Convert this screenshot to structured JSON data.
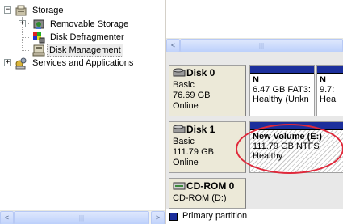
{
  "tree": {
    "items": [
      {
        "label": "Storage",
        "expander": "−",
        "icon": "storage-icon"
      },
      {
        "label": "Removable Storage",
        "expander": "+",
        "icon": "removable-storage-icon"
      },
      {
        "label": "Disk Defragmenter",
        "expander": "",
        "icon": "defragmenter-icon"
      },
      {
        "label": "Disk Management",
        "expander": "",
        "icon": "disk-management-icon",
        "selected": true
      },
      {
        "label": "Services and Applications",
        "expander": "+",
        "icon": "services-icon"
      }
    ]
  },
  "scroll": {
    "left_arrow": "<",
    "right_arrow": ">",
    "thumb_grip": "|||"
  },
  "disks": [
    {
      "name": "Disk 0",
      "type": "Basic",
      "size": "76.69 GB",
      "status": "Online",
      "partitions": [
        {
          "name": "N",
          "detail": "6.47 GB FAT3:",
          "health": "Healthy (Unkn"
        },
        {
          "name": "N",
          "detail": "9.7:",
          "health": "Hea"
        }
      ]
    },
    {
      "name": "Disk 1",
      "type": "Basic",
      "size": "111.79 GB",
      "status": "Online",
      "partitions": [
        {
          "name": "New Volume  (E:)",
          "detail": "111.79 GB NTFS",
          "health": "Healthy"
        }
      ]
    },
    {
      "name": "CD-ROM 0",
      "type": "CD-ROM (D:)",
      "size": "",
      "status": ""
    }
  ],
  "legend": {
    "label": "Primary partition",
    "color": "#1c2f9c"
  },
  "colors": {
    "partition_bar": "#1c2f9c",
    "highlight_ellipse": "#e0283a"
  }
}
